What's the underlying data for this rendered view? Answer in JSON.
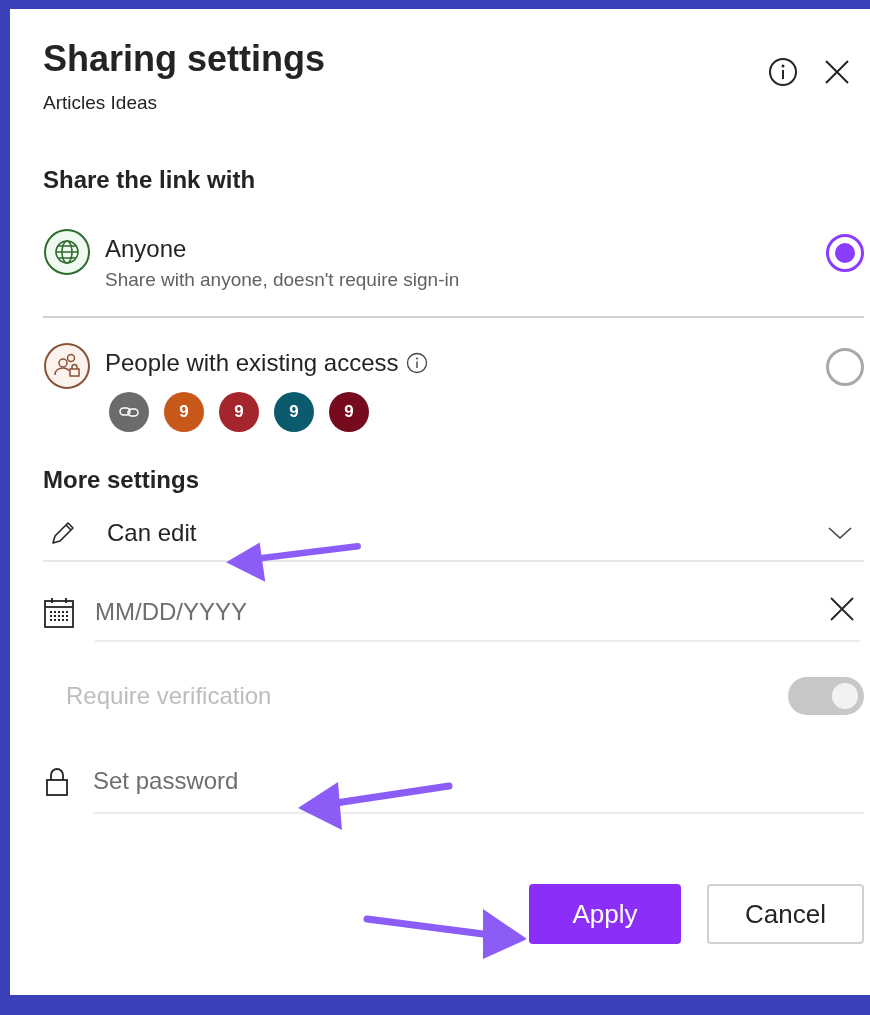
{
  "dialog": {
    "title": "Sharing settings",
    "subtitle": "Articles Ideas"
  },
  "share_section": {
    "heading": "Share the link with",
    "options": [
      {
        "kind": "anyone",
        "label": "Anyone",
        "description": "Share with anyone, doesn't require sign-in",
        "selected": true
      },
      {
        "kind": "existing",
        "label": "People with existing access",
        "selected": false,
        "avatars": [
          {
            "kind": "link",
            "color": "#6b6b6b"
          },
          {
            "kind": "initial",
            "text": "9",
            "color": "#c8581a"
          },
          {
            "kind": "initial",
            "text": "9",
            "color": "#a4262c"
          },
          {
            "kind": "initial",
            "text": "9",
            "color": "#0b5a6e"
          },
          {
            "kind": "initial",
            "text": "9",
            "color": "#750b1c"
          }
        ]
      }
    ]
  },
  "more_settings": {
    "heading": "More settings",
    "permission": "Can edit",
    "expiry": {
      "placeholder": "MM/DD/YYYY"
    },
    "verification": {
      "label": "Require verification",
      "on": true,
      "disabled": true
    },
    "password": {
      "placeholder": "Set password"
    }
  },
  "buttons": [
    {
      "kind": "primary",
      "label": "Apply"
    },
    {
      "kind": "secondary",
      "label": "Cancel"
    }
  ]
}
